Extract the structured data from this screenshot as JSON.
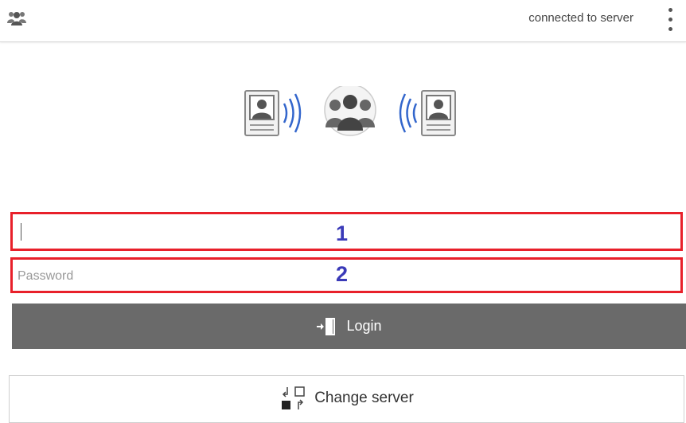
{
  "header": {
    "status": "connected to server",
    "app_icon": "group-people-icon",
    "menu_icon": "overflow-menu-icon"
  },
  "hero": {
    "icons": [
      "contact-card-icon",
      "signal-waves-icon",
      "group-people-icon",
      "signal-waves-icon",
      "contact-card-icon"
    ],
    "wave_color": "#3366cc"
  },
  "form": {
    "username": {
      "value": "",
      "placeholder": "",
      "marker": "1"
    },
    "password": {
      "value": "",
      "placeholder": "Password",
      "marker": "2"
    },
    "highlight_color": "#e8202a",
    "marker_color": "#3a3ab8"
  },
  "login_button": {
    "label": "Login",
    "icon": "sign-in-door-icon",
    "color": "#6a6a6a"
  },
  "change_server_button": {
    "label": "Change server",
    "icon": "switch-server-icon"
  }
}
